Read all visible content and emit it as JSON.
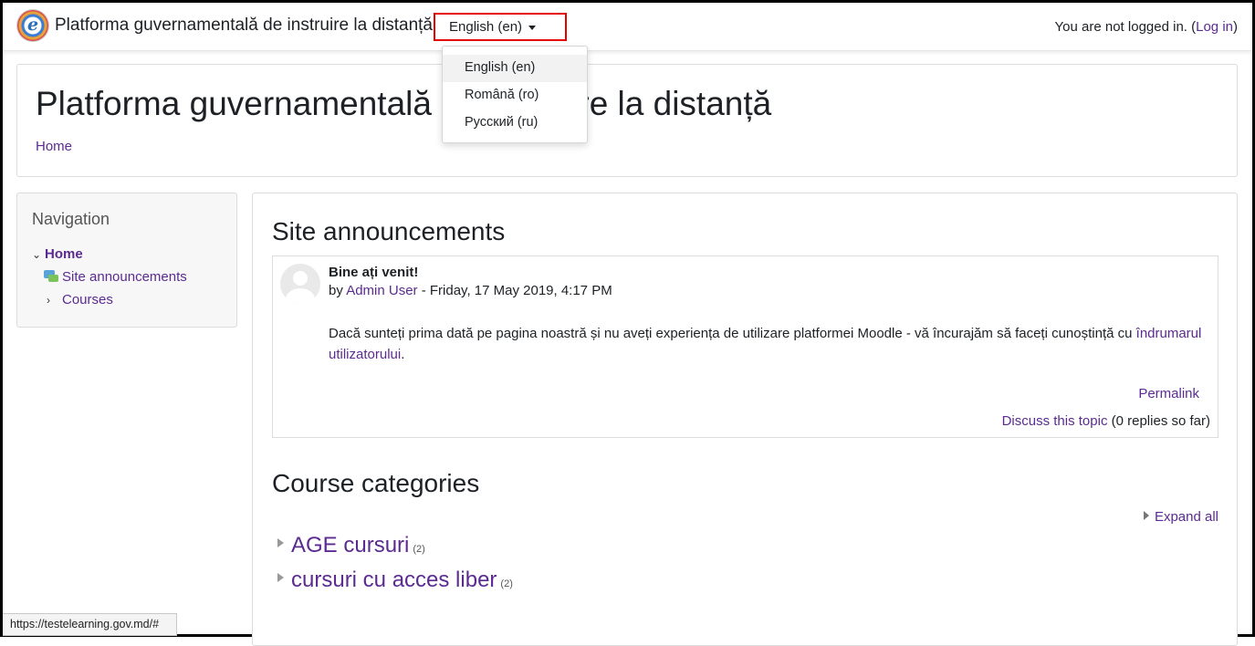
{
  "navbar": {
    "brand": "Platforma guvernamentală de instruire la distanță",
    "logo_letter": "e",
    "language_current": "English (en)",
    "login_prefix": "You are not logged in. (",
    "login_link": "Log in",
    "login_suffix": ")"
  },
  "language_menu": {
    "items": [
      {
        "label": "English (en)"
      },
      {
        "label": "Română (ro)"
      },
      {
        "label": "Русский (ru)"
      }
    ]
  },
  "header": {
    "title": "Platforma guvernamentală de instruire la distanță",
    "breadcrumb": "Home"
  },
  "navigation": {
    "title": "Navigation",
    "home": "Home",
    "site_announcements": "Site announcements",
    "courses": "Courses"
  },
  "announcements": {
    "heading": "Site announcements",
    "post": {
      "subject": "Bine ați venit!",
      "by": "by ",
      "author": "Admin User",
      "date": " - Friday, 17 May 2019, 4:17 PM",
      "body_text": "Dacă sunteți prima dată pe pagina noastră și nu aveți experiența de utilizare platformei Moodle - vă încurajăm să faceți cunoștință cu ",
      "body_link": "îndrumarul utilizatorului",
      "body_end": ".",
      "permalink": "Permalink",
      "discuss": "Discuss this topic",
      "replies": " (0 replies so far)"
    }
  },
  "categories": {
    "heading": "Course categories",
    "expand_all": "Expand all",
    "items": [
      {
        "name": "AGE cursuri",
        "count": "(2)"
      },
      {
        "name": "cursuri cu acces liber",
        "count": "(2)"
      }
    ]
  },
  "statusbar": {
    "url": "https://testelearning.gov.md/#"
  },
  "colors": {
    "link": "#5b2b91",
    "highlight_border": "#e60000"
  }
}
